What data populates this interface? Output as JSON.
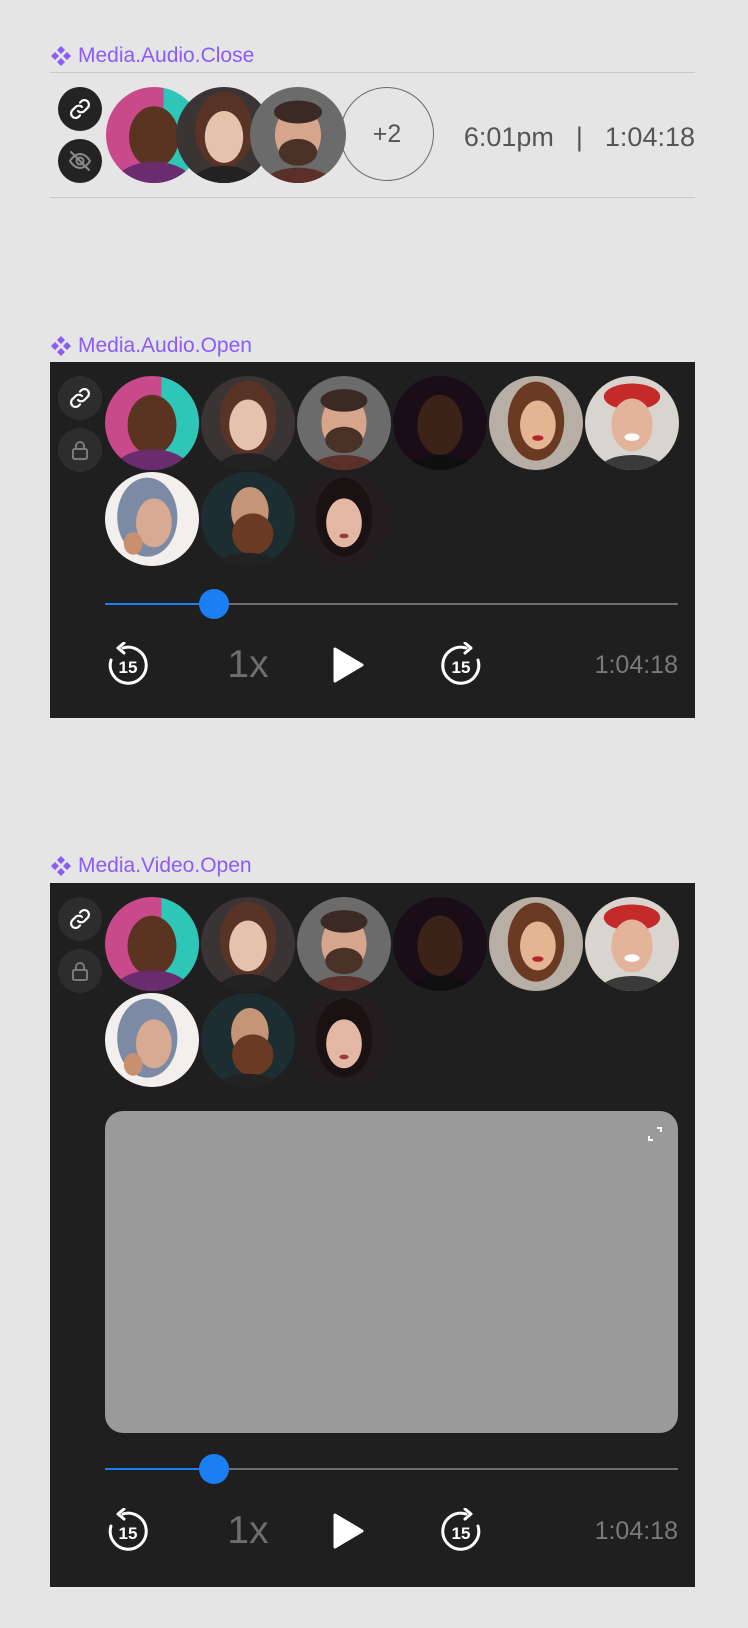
{
  "sections": {
    "audio_close": {
      "title": "Media.Audio.Close"
    },
    "audio_open": {
      "title": "Media.Audio.Open"
    },
    "video_open": {
      "title": "Media.Video.Open"
    }
  },
  "closed": {
    "more_count": "+2",
    "clock": "6:01pm",
    "separator": "|",
    "duration": "1:04:18"
  },
  "audio_open": {
    "speed": "1x",
    "duration": "1:04:18",
    "progress": 0.19
  },
  "video_open": {
    "speed": "1x",
    "duration": "1:04:18",
    "progress": 0.19
  },
  "icons": {
    "link": "link-icon",
    "hidden": "eye-off-icon",
    "lock": "lock-icon",
    "rewind": "rewind-15-icon",
    "forward": "forward-15-icon",
    "play": "play-icon",
    "expand": "expand-icon",
    "component": "component-icon"
  },
  "rewind_label": "15",
  "colors": {
    "accent": "#1a7ff2",
    "title": "#8b5cf6",
    "panel": "#1f1f1f"
  }
}
